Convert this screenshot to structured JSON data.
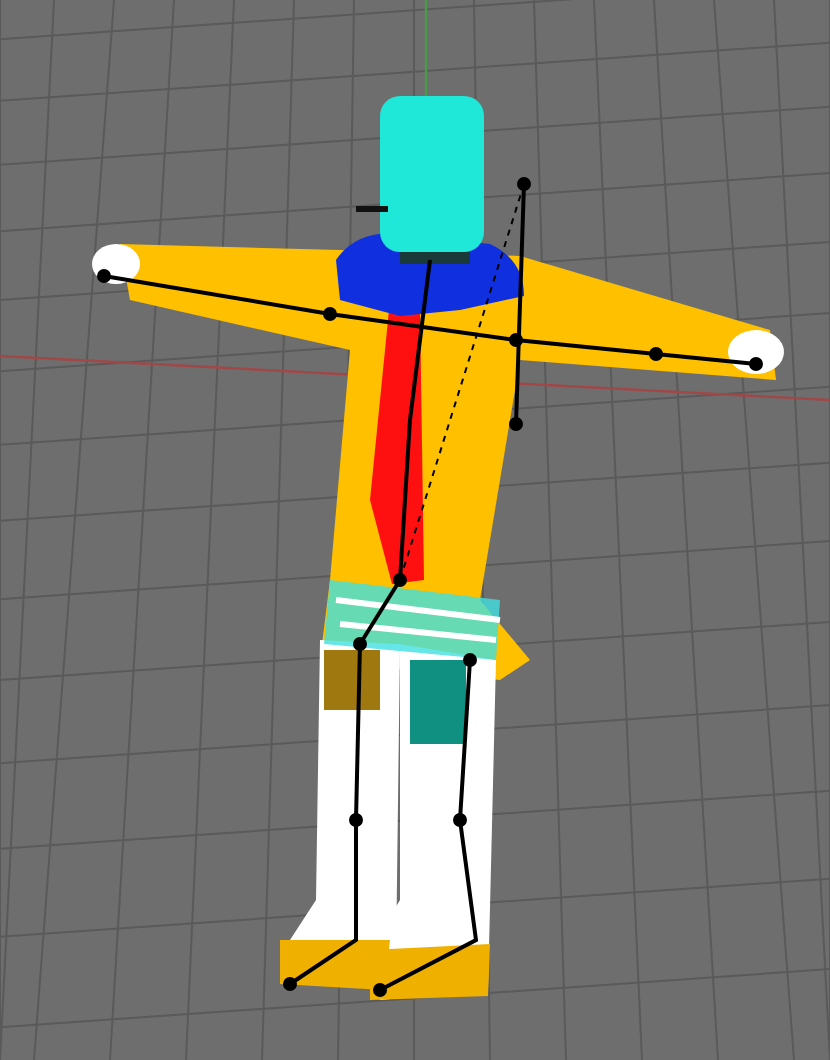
{
  "viewport": {
    "kind": "perspective-grid",
    "model": {
      "kind": "t-pose-figure",
      "skeleton_visible": true
    }
  }
}
